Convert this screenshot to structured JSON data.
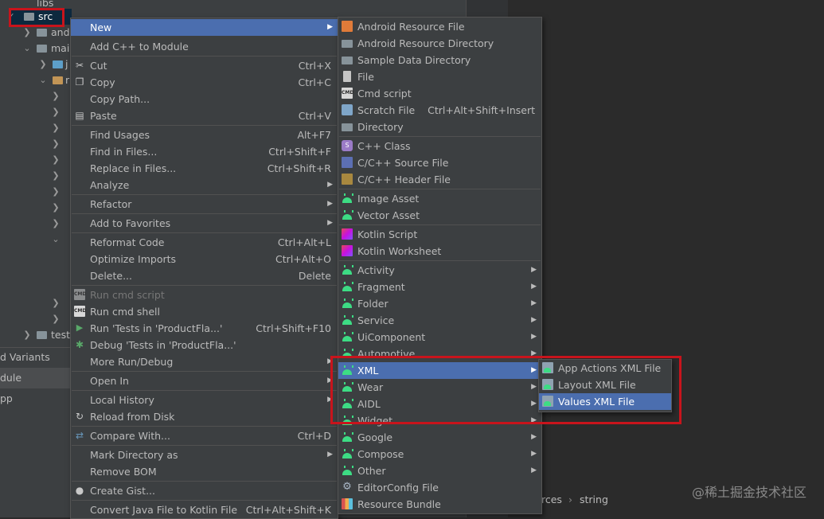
{
  "project_tree": {
    "rows": [
      {
        "label": "libs"
      },
      {
        "label": "src"
      },
      {
        "label": "and"
      },
      {
        "label": "mai"
      },
      {
        "label": "j"
      },
      {
        "label": "r"
      },
      {
        "label": "test"
      }
    ],
    "side_tabs": [
      "d Variants",
      "dule",
      "pp"
    ]
  },
  "context_menu": {
    "items": [
      {
        "label": "New",
        "shortcut": "",
        "submenu": true,
        "selected": true
      },
      {
        "label": "Add C++ to Module",
        "shortcut": ""
      },
      {
        "label": "Cut",
        "shortcut": "Ctrl+X",
        "icon": "scissors-icon"
      },
      {
        "label": "Copy",
        "shortcut": "Ctrl+C",
        "icon": "copy-icon"
      },
      {
        "label": "Copy Path...",
        "shortcut": ""
      },
      {
        "label": "Paste",
        "shortcut": "Ctrl+V",
        "icon": "paste-icon"
      },
      {
        "label": "Find Usages",
        "shortcut": "Alt+F7"
      },
      {
        "label": "Find in Files...",
        "shortcut": "Ctrl+Shift+F"
      },
      {
        "label": "Replace in Files...",
        "shortcut": "Ctrl+Shift+R"
      },
      {
        "label": "Analyze",
        "shortcut": "",
        "submenu": true
      },
      {
        "label": "Refactor",
        "shortcut": "",
        "submenu": true
      },
      {
        "label": "Add to Favorites",
        "shortcut": "",
        "submenu": true
      },
      {
        "label": "Reformat Code",
        "shortcut": "Ctrl+Alt+L"
      },
      {
        "label": "Optimize Imports",
        "shortcut": "Ctrl+Alt+O"
      },
      {
        "label": "Delete...",
        "shortcut": "Delete"
      },
      {
        "label": "Run cmd script",
        "shortcut": "",
        "disabled": true,
        "icon": "cmd-icon"
      },
      {
        "label": "Run cmd shell",
        "shortcut": "",
        "icon": "cmd-icon"
      },
      {
        "label": "Run 'Tests in 'ProductFla...'",
        "shortcut": "Ctrl+Shift+F10",
        "icon": "run-icon"
      },
      {
        "label": "Debug 'Tests in 'ProductFla...'",
        "shortcut": "",
        "icon": "debug-icon"
      },
      {
        "label": "More Run/Debug",
        "shortcut": "",
        "submenu": true
      },
      {
        "label": "Open In",
        "shortcut": "",
        "submenu": true
      },
      {
        "label": "Local History",
        "shortcut": "",
        "submenu": true
      },
      {
        "label": "Reload from Disk",
        "shortcut": "",
        "icon": "reload-icon"
      },
      {
        "label": "Compare With...",
        "shortcut": "Ctrl+D",
        "icon": "compare-icon"
      },
      {
        "label": "Mark Directory as",
        "shortcut": "",
        "submenu": true
      },
      {
        "label": "Remove BOM",
        "shortcut": ""
      },
      {
        "label": "Create Gist...",
        "shortcut": "",
        "icon": "github-icon"
      },
      {
        "label": "Convert Java File to Kotlin File",
        "shortcut": "Ctrl+Alt+Shift+K"
      }
    ]
  },
  "new_submenu": {
    "items": [
      {
        "label": "Android Resource File",
        "shortcut": "",
        "icon": "android-resource-file-icon"
      },
      {
        "label": "Android Resource Directory",
        "shortcut": "",
        "icon": "folder-icon"
      },
      {
        "label": "Sample Data Directory",
        "shortcut": "",
        "icon": "folder-icon"
      },
      {
        "label": "File",
        "shortcut": "",
        "icon": "file-icon"
      },
      {
        "label": "Cmd script",
        "shortcut": "",
        "icon": "cmd-icon"
      },
      {
        "label": "Scratch File",
        "shortcut": "Ctrl+Alt+Shift+Insert",
        "icon": "scratch-icon"
      },
      {
        "label": "Directory",
        "shortcut": "",
        "icon": "folder-icon"
      },
      {
        "label": "C++ Class",
        "shortcut": "",
        "icon": "cpp-class-icon"
      },
      {
        "label": "C/C++ Source File",
        "shortcut": "",
        "icon": "c-source-icon"
      },
      {
        "label": "C/C++ Header File",
        "shortcut": "",
        "icon": "c-header-icon"
      },
      {
        "label": "Image Asset",
        "shortcut": "",
        "icon": "android-icon"
      },
      {
        "label": "Vector Asset",
        "shortcut": "",
        "icon": "android-icon"
      },
      {
        "label": "Kotlin Script",
        "shortcut": "",
        "icon": "kotlin-icon"
      },
      {
        "label": "Kotlin Worksheet",
        "shortcut": "",
        "icon": "kotlin-icon"
      },
      {
        "label": "Activity",
        "shortcut": "",
        "submenu": true,
        "icon": "android-icon"
      },
      {
        "label": "Fragment",
        "shortcut": "",
        "submenu": true,
        "icon": "android-icon"
      },
      {
        "label": "Folder",
        "shortcut": "",
        "submenu": true,
        "icon": "android-icon"
      },
      {
        "label": "Service",
        "shortcut": "",
        "submenu": true,
        "icon": "android-icon"
      },
      {
        "label": "UiComponent",
        "shortcut": "",
        "submenu": true,
        "icon": "android-icon"
      },
      {
        "label": "Automotive",
        "shortcut": "",
        "submenu": true,
        "icon": "android-icon"
      },
      {
        "label": "XML",
        "shortcut": "",
        "submenu": true,
        "selected": true,
        "icon": "android-icon"
      },
      {
        "label": "Wear",
        "shortcut": "",
        "submenu": true,
        "icon": "android-icon"
      },
      {
        "label": "AIDL",
        "shortcut": "",
        "submenu": true,
        "icon": "android-icon"
      },
      {
        "label": "Widget",
        "shortcut": "",
        "submenu": true,
        "icon": "android-icon"
      },
      {
        "label": "Google",
        "shortcut": "",
        "submenu": true,
        "icon": "android-icon"
      },
      {
        "label": "Compose",
        "shortcut": "",
        "submenu": true,
        "icon": "android-icon"
      },
      {
        "label": "Other",
        "shortcut": "",
        "submenu": true,
        "icon": "android-icon"
      },
      {
        "label": "EditorConfig File",
        "shortcut": "",
        "icon": "gear-icon"
      },
      {
        "label": "Resource Bundle",
        "shortcut": "",
        "icon": "resource-bundle-icon"
      }
    ]
  },
  "xml_submenu": {
    "items": [
      {
        "label": "App Actions XML File",
        "icon": "xml-file-icon"
      },
      {
        "label": "Layout XML File",
        "icon": "xml-file-icon"
      },
      {
        "label": "Values XML File",
        "icon": "xml-file-icon",
        "selected": true
      }
    ]
  },
  "breadcrumb": {
    "part1": "rces",
    "part2": "string"
  },
  "watermark": "@稀土掘金技术社区",
  "colors": {
    "selection": "#4b6eaf",
    "highlight_box": "#c8141c",
    "background": "#3c3f41"
  }
}
